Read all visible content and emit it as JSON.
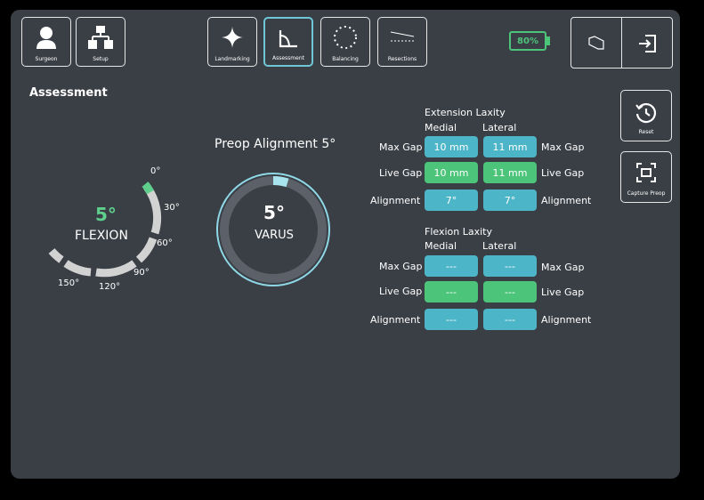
{
  "toolbar": {
    "surgeon": "Surgeon",
    "setup": "Setup",
    "landmarking": "Landmarking",
    "assessment": "Assessment",
    "balancing": "Balancing",
    "resections": "Resections"
  },
  "battery": {
    "percent": "80%",
    "color": "#4cc47a"
  },
  "section_title": "Assessment",
  "side": {
    "reset": "Reset",
    "capture": "Capture Preop"
  },
  "flexion": {
    "value": "5°",
    "label": "FLEXION",
    "ticks": [
      "0°",
      "30°",
      "60°",
      "90°",
      "120°",
      "150°"
    ],
    "progress_fraction": 0.03
  },
  "preop": {
    "title": "Preop Alignment 5°",
    "value": "5°",
    "label": "VARUS"
  },
  "extension": {
    "title": "Extension Laxity",
    "medial": "Medial",
    "lateral": "Lateral",
    "rows": [
      {
        "label": "Max Gap",
        "medial": "10 mm",
        "lateral": "11 mm",
        "right": "Max Gap"
      },
      {
        "label": "Live Gap",
        "medial": "10 mm",
        "lateral": "11 mm",
        "right": "Live Gap"
      },
      {
        "label": "Alignment",
        "medial": "7°",
        "lateral": "7°",
        "right": "Alignment"
      }
    ]
  },
  "flexion_laxity": {
    "title": "Flexion Laxity",
    "medial": "Medial",
    "lateral": "Lateral",
    "rows": [
      {
        "label": "Max Gap",
        "medial": "---",
        "lateral": "---",
        "right": "Max Gap"
      },
      {
        "label": "Live Gap",
        "medial": "---",
        "lateral": "---",
        "right": "Live Gap"
      },
      {
        "label": "Alignment",
        "medial": "---",
        "lateral": "---",
        "right": "Alignment"
      }
    ]
  },
  "colors": {
    "accent_blue": "#4db5c8",
    "accent_green": "#4cc47a",
    "background": "#3a3f46"
  }
}
